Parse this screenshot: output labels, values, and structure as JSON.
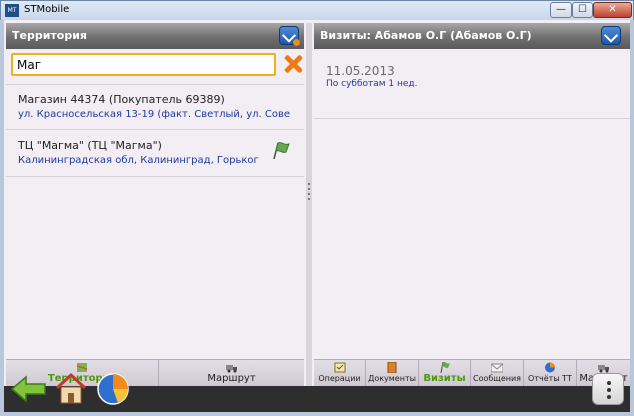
{
  "window": {
    "title": "STMobile",
    "icon_text": "MT",
    "minimize": "—",
    "maximize": "☐",
    "close": "✕"
  },
  "left_panel": {
    "title": "Территория",
    "search": {
      "value": "Маг"
    },
    "items": [
      {
        "name": "Магазин 44374 (Покупатель 69389)",
        "address": "ул. Красносельская  13-19 (факт. Светлый, ул. Сове"
      },
      {
        "name": "ТЦ \"Магма\" (ТЦ \"Магма\")",
        "address": "Калининградская обл, Калининград, Горьког"
      }
    ],
    "tabs": [
      {
        "label": "Территория",
        "icon": "territory-icon",
        "active": true
      },
      {
        "label": "Маршрут",
        "icon": "route-truck-icon",
        "active": false
      }
    ]
  },
  "right_panel": {
    "title": "Визиты: Абамов О.Г (Абамов О.Г)",
    "visit": {
      "date": "11.05.2013",
      "schedule": "По субботам 1 нед."
    },
    "tabs": [
      {
        "label": "Операции",
        "icon": "operations-icon",
        "active": false
      },
      {
        "label": "Документы",
        "icon": "documents-icon",
        "active": false
      },
      {
        "label": "Визиты",
        "icon": "visits-flag-icon",
        "active": true
      },
      {
        "label": "Сообщения",
        "icon": "messages-icon",
        "active": false
      },
      {
        "label": "Отчёты ТТ",
        "icon": "reports-icon",
        "active": false
      },
      {
        "label": "Маршрут",
        "icon": "route-truck-icon",
        "active": false
      }
    ]
  },
  "colors": {
    "accent_orange": "#f08a1c",
    "active_tab_green": "#4a9a0c",
    "link_blue": "#1d3aa0",
    "header_gray": "#6f6f6f"
  }
}
